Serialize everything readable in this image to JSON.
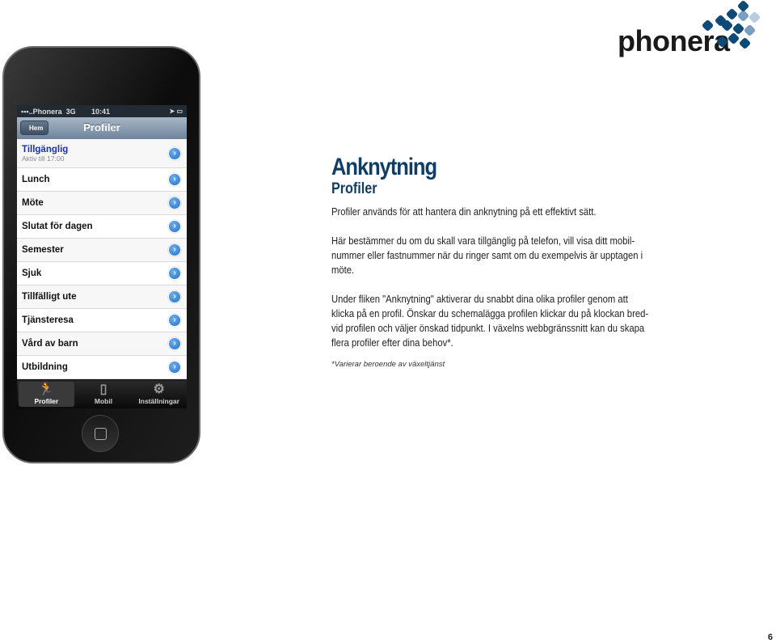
{
  "brand": {
    "logo_text": "phonera",
    "colors": {
      "primary": "#0e4a78",
      "heading": "#0e3d66"
    }
  },
  "phone": {
    "status": {
      "carrier": "Phonera",
      "network": "3G",
      "time": "10:41"
    },
    "nav": {
      "back_label": "Hem",
      "title": "Profiler"
    },
    "profiles": [
      {
        "label": "Tillgänglig",
        "sub": "Aktiv till 17:00",
        "active": true
      },
      {
        "label": "Lunch"
      },
      {
        "label": "Möte"
      },
      {
        "label": "Slutat för dagen"
      },
      {
        "label": "Semester"
      },
      {
        "label": "Sjuk"
      },
      {
        "label": "Tillfälligt ute"
      },
      {
        "label": "Tjänsteresa"
      },
      {
        "label": "Vård av barn"
      },
      {
        "label": "Utbildning"
      }
    ],
    "tabs": [
      {
        "label": "Profiler",
        "icon": "runner-icon",
        "active": true
      },
      {
        "label": "Mobil",
        "icon": "mobile-icon"
      },
      {
        "label": "Inställningar",
        "icon": "gear-icon"
      }
    ]
  },
  "content": {
    "title": "Anknytning",
    "subtitle": "Profiler",
    "paragraphs": [
      [
        "Profiler används för att hantera din anknytning på ett effektivt sätt."
      ],
      [
        "Här bestämmer du om du skall vara tillgänglig på telefon, vill visa ditt mobil-",
        "nummer eller fastnummer när du ringer samt om du exempelvis är upptagen i",
        "möte."
      ],
      [
        "Under fliken \"Anknytning\" aktiverar du snabbt dina olika profiler genom att",
        "klicka på en profil. Önskar du schemalägga profilen klickar du på klockan bred-",
        "vid profilen och väljer önskad tidpunkt.  I växelns webbgränssnitt kan du skapa",
        "flera profiler efter dina behov*."
      ]
    ],
    "footnote": "*Varierar beroende av växeltjänst"
  },
  "page_number": "6"
}
